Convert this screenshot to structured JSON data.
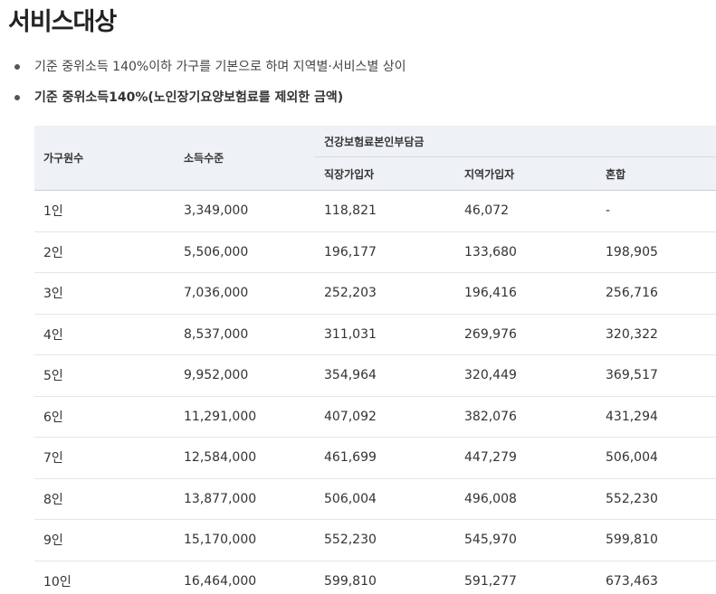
{
  "title": "서비스대상",
  "bullets": [
    "기준 중위소득 140%이하 가구를 기본으로 하며 지역별·서비스별 상이",
    "기준 중위소득140%(노인장기요양보험료를 제외한 금액)"
  ],
  "table": {
    "headers": {
      "household": "가구원수",
      "income": "소득수준",
      "premium_group": "건강보험료본인부담금",
      "employee": "직장가입자",
      "regional": "지역가입자",
      "mixed": "혼합"
    },
    "rows": [
      [
        "1인",
        "3,349,000",
        "118,821",
        "46,072",
        "-"
      ],
      [
        "2인",
        "5,506,000",
        "196,177",
        "133,680",
        "198,905"
      ],
      [
        "3인",
        "7,036,000",
        "252,203",
        "196,416",
        "256,716"
      ],
      [
        "4인",
        "8,537,000",
        "311,031",
        "269,976",
        "320,322"
      ],
      [
        "5인",
        "9,952,000",
        "354,964",
        "320,449",
        "369,517"
      ],
      [
        "6인",
        "11,291,000",
        "407,092",
        "382,076",
        "431,294"
      ],
      [
        "7인",
        "12,584,000",
        "461,699",
        "447,279",
        "506,004"
      ],
      [
        "8인",
        "13,877,000",
        "506,004",
        "496,008",
        "552,230"
      ],
      [
        "9인",
        "15,170,000",
        "552,230",
        "545,970",
        "599,810"
      ],
      [
        "10인",
        "16,464,000",
        "599,810",
        "591,277",
        "673,463"
      ]
    ]
  }
}
